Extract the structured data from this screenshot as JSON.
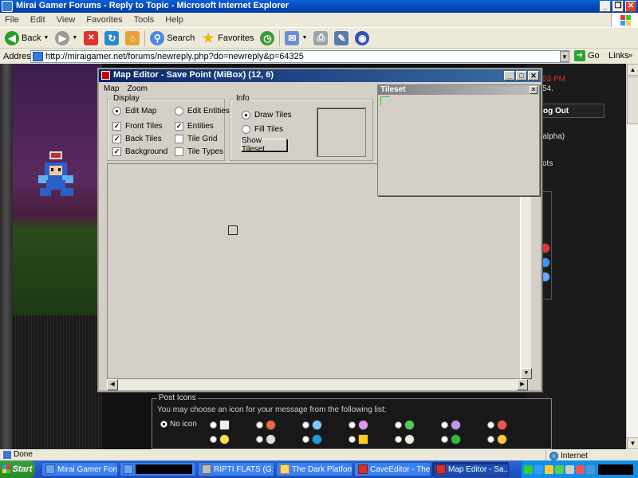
{
  "ie": {
    "title": "Mirai Gamer Forums - Reply to Topic - Microsoft Internet Explorer",
    "menu": [
      "File",
      "Edit",
      "View",
      "Favorites",
      "Tools",
      "Help"
    ],
    "toolbar": {
      "back": "Back",
      "search": "Search",
      "favorites": "Favorites"
    },
    "address_label": "Address",
    "address": "http://miraigamer.net/forums/newreply.php?do=newreply&p=64325",
    "go": "Go",
    "links": "Links",
    "status_left": "Done",
    "status_right": "Internet"
  },
  "forum": {
    "time_fragment": "03 PM",
    "msg_fragment": "54.",
    "logout": "og Out",
    "alpha": "a alpha)",
    "bots": "ots",
    "post_icons_legend": "Post Icons",
    "post_icons_desc": "You may choose an icon for your message from the following list:",
    "no_icon": "No icon"
  },
  "map_editor": {
    "title": "Map Editor - Save Point (MiBox) (12, 6)",
    "menu": [
      "Map",
      "Zoom"
    ],
    "display": {
      "legend": "Display",
      "edit_map": "Edit Map",
      "edit_entities": "Edit Entities",
      "front_tiles": "Front Tiles",
      "back_tiles": "Back Tiles",
      "background": "Background",
      "entities": "Entities",
      "tile_grid": "Tile Grid",
      "tile_types": "Tile Types"
    },
    "info": {
      "legend": "Info",
      "draw_tiles": "Draw Tiles",
      "fill_tiles": "Fill Tiles",
      "show_tileset": "Show Tileset"
    },
    "state": {
      "mode": "Edit Map",
      "draw_mode": "Draw Tiles",
      "front_tiles": true,
      "back_tiles": true,
      "background": true,
      "entities": true,
      "tile_grid": false,
      "tile_types": false
    }
  },
  "tileset": {
    "title": "Tileset"
  },
  "taskbar": {
    "start": "Start",
    "tasks": [
      "Mirai Gamer Foru...",
      "",
      "RIPTI FLATS (G:)",
      "The Dark Platform",
      "CaveEditor - The ...",
      "Map Editor - Sa..."
    ],
    "active_index": 5
  },
  "colors": {
    "xp_blue": "#0547b8",
    "taskbar": "#2456c4",
    "start_green": "#2a8a2a",
    "editor_title": "#0a246a"
  }
}
